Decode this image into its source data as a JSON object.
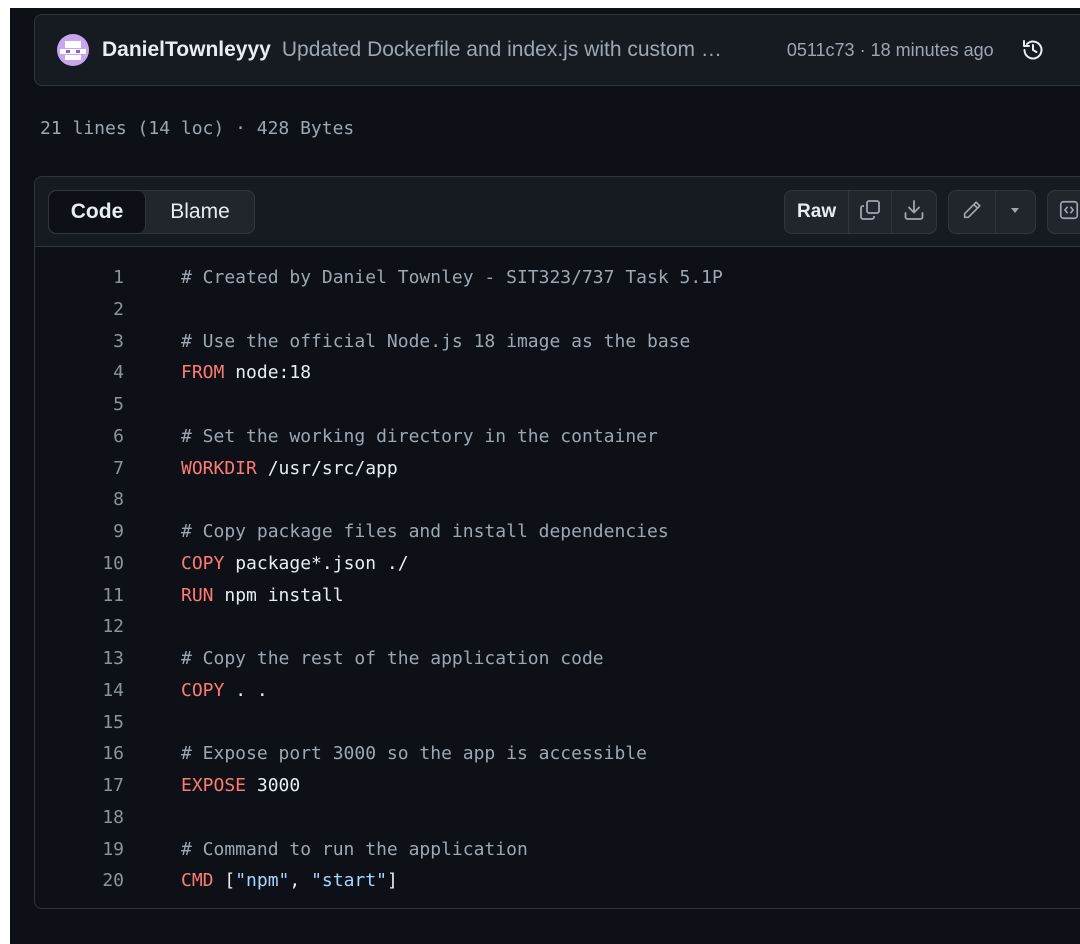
{
  "commit": {
    "author": "DanielTownleyyy",
    "message": "Updated Dockerfile and index.js with custom …",
    "sha_time": "0511c73 · 18 minutes ago"
  },
  "file_info": "21 lines (14 loc) · 428 Bytes",
  "toolbar": {
    "tabs": [
      {
        "label": "Code",
        "active": true
      },
      {
        "label": "Blame",
        "active": false
      }
    ],
    "raw_label": "Raw"
  },
  "icons": {
    "history": "history-icon",
    "copy": "copy-icon",
    "download": "download-icon",
    "edit": "pencil-icon",
    "dropdown": "triangle-down-icon",
    "symbols": "code-square-icon"
  },
  "colors": {
    "background": "#0d1117",
    "header": "#161b22",
    "border": "#30363d",
    "comment": "#9da7b3",
    "keyword": "#ff7b72",
    "string": "#a5d6ff",
    "text": "#e6edf3",
    "line_number": "#8b949e"
  },
  "code_lines": [
    {
      "n": "1",
      "tokens": [
        {
          "t": "comment",
          "v": "# Created by Daniel Townley - SIT323/737 Task 5.1P"
        }
      ]
    },
    {
      "n": "2",
      "tokens": []
    },
    {
      "n": "3",
      "tokens": [
        {
          "t": "comment",
          "v": "# Use the official Node.js 18 image as the base"
        }
      ]
    },
    {
      "n": "4",
      "tokens": [
        {
          "t": "keyword",
          "v": "FROM"
        },
        {
          "t": "text",
          "v": " node:18"
        }
      ]
    },
    {
      "n": "5",
      "tokens": []
    },
    {
      "n": "6",
      "tokens": [
        {
          "t": "comment",
          "v": "# Set the working directory in the container"
        }
      ]
    },
    {
      "n": "7",
      "tokens": [
        {
          "t": "keyword",
          "v": "WORKDIR"
        },
        {
          "t": "text",
          "v": " /usr/src/app"
        }
      ]
    },
    {
      "n": "8",
      "tokens": []
    },
    {
      "n": "9",
      "tokens": [
        {
          "t": "comment",
          "v": "# Copy package files and install dependencies"
        }
      ]
    },
    {
      "n": "10",
      "tokens": [
        {
          "t": "keyword",
          "v": "COPY"
        },
        {
          "t": "text",
          "v": " package*.json ./"
        }
      ]
    },
    {
      "n": "11",
      "tokens": [
        {
          "t": "keyword",
          "v": "RUN"
        },
        {
          "t": "text",
          "v": " npm install"
        }
      ]
    },
    {
      "n": "12",
      "tokens": []
    },
    {
      "n": "13",
      "tokens": [
        {
          "t": "comment",
          "v": "# Copy the rest of the application code"
        }
      ]
    },
    {
      "n": "14",
      "tokens": [
        {
          "t": "keyword",
          "v": "COPY"
        },
        {
          "t": "text",
          "v": " . ."
        }
      ]
    },
    {
      "n": "15",
      "tokens": []
    },
    {
      "n": "16",
      "tokens": [
        {
          "t": "comment",
          "v": "# Expose port 3000 so the app is accessible"
        }
      ]
    },
    {
      "n": "17",
      "tokens": [
        {
          "t": "keyword",
          "v": "EXPOSE"
        },
        {
          "t": "text",
          "v": " 3000"
        }
      ]
    },
    {
      "n": "18",
      "tokens": []
    },
    {
      "n": "19",
      "tokens": [
        {
          "t": "comment",
          "v": "# Command to run the application"
        }
      ]
    },
    {
      "n": "20",
      "tokens": [
        {
          "t": "keyword",
          "v": "CMD"
        },
        {
          "t": "text",
          "v": " ["
        },
        {
          "t": "string",
          "v": "\"npm\""
        },
        {
          "t": "text",
          "v": ", "
        },
        {
          "t": "string",
          "v": "\"start\""
        },
        {
          "t": "text",
          "v": "]"
        }
      ]
    }
  ]
}
